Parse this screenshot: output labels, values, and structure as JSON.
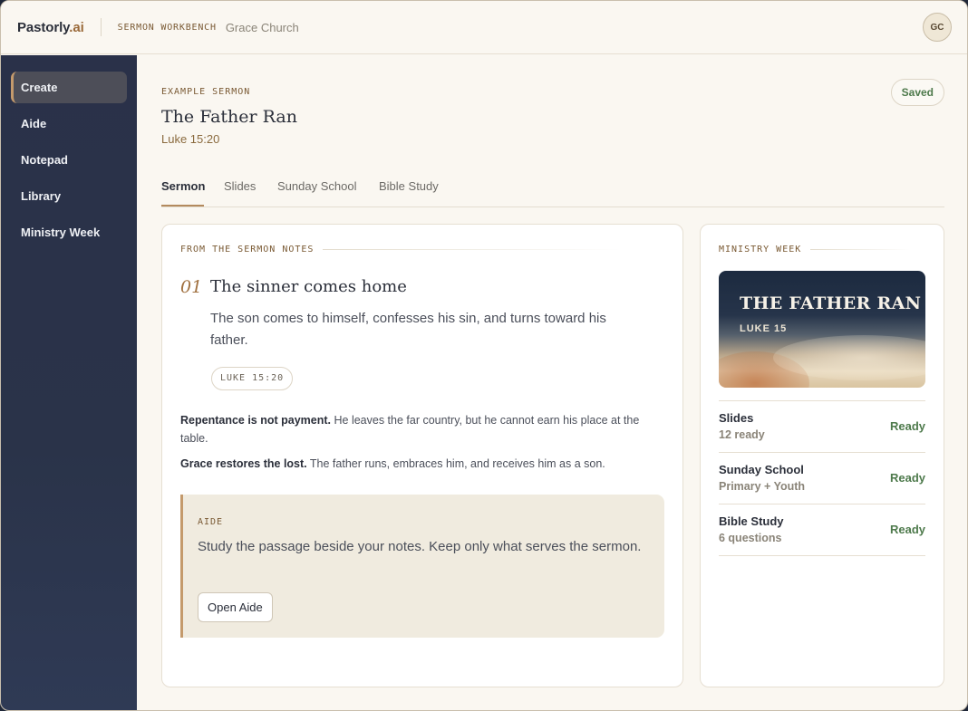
{
  "app": {
    "brand_main": "Pastorly",
    "brand_suffix": ".ai",
    "workspace": "SERMON WORKBENCH",
    "church": "Grace Church",
    "avatar_initials": "GC"
  },
  "sidebar": {
    "items": [
      {
        "label": "Create",
        "active": true
      },
      {
        "label": "Aide"
      },
      {
        "label": "Notepad"
      },
      {
        "label": "Library"
      },
      {
        "label": "Ministry Week"
      }
    ]
  },
  "header": {
    "eyebrow": "EXAMPLE SERMON",
    "title": "The Father Ran",
    "reference": "Luke 15:20",
    "status": "Saved"
  },
  "tabs": [
    {
      "label": "Sermon",
      "active": true
    },
    {
      "label": "Slides"
    },
    {
      "label": "Sunday School"
    },
    {
      "label": "Bible Study"
    }
  ],
  "notes": {
    "kicker": "FROM THE SERMON NOTES",
    "point_number": "01",
    "point_title": "The sinner comes home",
    "point_body": "The son comes to himself, confesses his sin, and turns toward his father.",
    "scripture_chip": "LUKE 15:20",
    "paragraphs": [
      {
        "lead": "Repentance is not payment.",
        "text": " He leaves the far country, but he cannot earn his place at the table."
      },
      {
        "lead": "Grace restores the lost.",
        "text": " The father runs, embraces him, and receives him as a son."
      }
    ]
  },
  "aide": {
    "kicker": "AIDE",
    "text": "Study the passage beside your notes. Keep only what serves the sermon.",
    "button": "Open Aide"
  },
  "ministry_week": {
    "kicker": "MINISTRY WEEK",
    "hero_title": "THE FATHER RAN",
    "hero_subtitle": "LUKE 15",
    "items": [
      {
        "name": "Slides",
        "detail": "12 ready",
        "status": "Ready"
      },
      {
        "name": "Sunday School",
        "detail": "Primary + Youth",
        "status": "Ready"
      },
      {
        "name": "Bible Study",
        "detail": "6 questions",
        "status": "Ready"
      }
    ]
  },
  "colors": {
    "accent": "#c49a6c",
    "ready": "#4e7a4c",
    "sidebar": "#2a3149"
  }
}
